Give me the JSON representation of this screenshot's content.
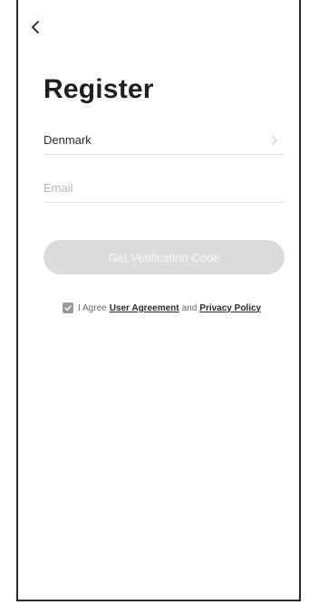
{
  "nav": {
    "back_icon": "chevron-left-icon"
  },
  "page": {
    "title": "Register"
  },
  "form": {
    "country": {
      "value": "Denmark",
      "icon": "chevron-right-icon"
    },
    "email": {
      "placeholder": "Email",
      "value": ""
    },
    "submit_label": "Get Verification Code"
  },
  "agreement": {
    "checked": true,
    "prefix": "I Agree",
    "user_agreement_link": "User Agreement",
    "conjunction": "and",
    "privacy_policy_link": "Privacy Policy"
  }
}
